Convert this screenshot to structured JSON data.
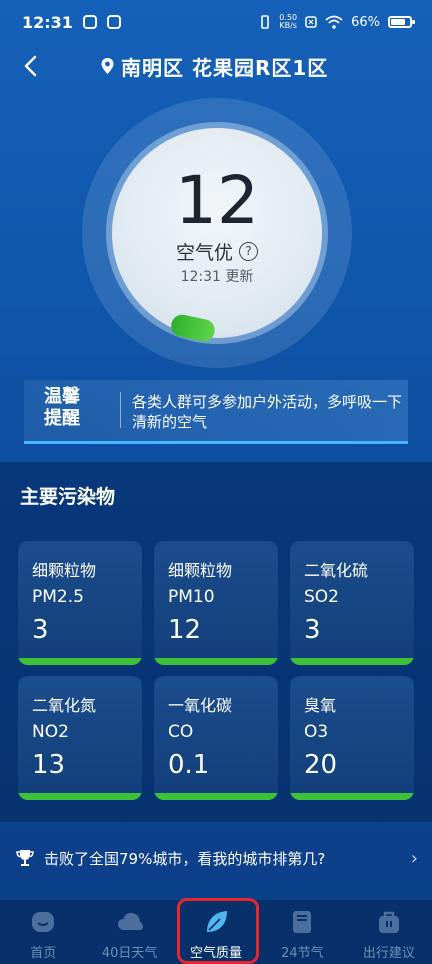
{
  "status_bar": {
    "time": "12:31",
    "netspeed_value": "0.50",
    "netspeed_unit": "KB/s",
    "battery": "66%"
  },
  "header": {
    "location": "南明区 花果园R区1区"
  },
  "gauge": {
    "aqi": "12",
    "level": "空气优",
    "update_time": "12:31 更新"
  },
  "tips": {
    "label_line1": "温馨",
    "label_line2": "提醒",
    "text": "各类人群可多参加户外活动，多呼吸一下清新的空气"
  },
  "pollutants": {
    "title": "主要污染物",
    "items": [
      {
        "name": "细颗粒物",
        "code": "PM2.5",
        "value": "3"
      },
      {
        "name": "细颗粒物",
        "code": "PM10",
        "value": "12"
      },
      {
        "name": "二氧化硫",
        "code": "SO2",
        "value": "3"
      },
      {
        "name": "二氧化氮",
        "code": "NO2",
        "value": "13"
      },
      {
        "name": "一氧化碳",
        "code": "CO",
        "value": "0.1"
      },
      {
        "name": "臭氧",
        "code": "O3",
        "value": "20"
      }
    ]
  },
  "rank": {
    "text": "击败了全国79%城市，看我的城市排第几?"
  },
  "bottom_nav": {
    "items": [
      {
        "label": "首页",
        "icon": "face-icon"
      },
      {
        "label": "40日天气",
        "icon": "cloud-icon"
      },
      {
        "label": "空气质量",
        "icon": "leaf-icon"
      },
      {
        "label": "24节气",
        "icon": "book-icon"
      },
      {
        "label": "出行建议",
        "icon": "bag-icon"
      }
    ],
    "active_index": 2
  },
  "colors": {
    "accent_green": "#3ec13a",
    "highlight_red": "#e8262e",
    "tip_border": "#47b5ff"
  }
}
